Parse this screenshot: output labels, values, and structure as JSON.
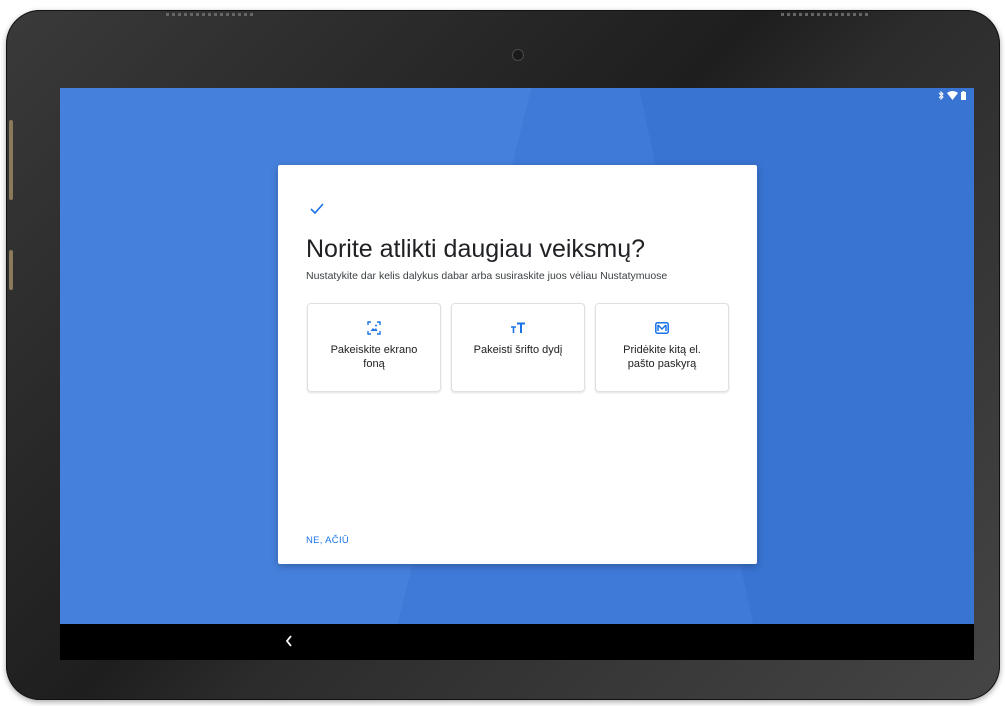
{
  "colors": {
    "accent": "#1a73e8",
    "wallpaper": "#3f7ad8",
    "bezel": "#2b2b2b",
    "navbar": "#000000",
    "card_bg": "#ffffff",
    "title_text": "#202124",
    "body_text": "#3c4043"
  },
  "status_bar": {
    "icons": [
      "bluetooth-icon",
      "wifi-icon",
      "battery-icon"
    ]
  },
  "dialog": {
    "check_icon": "check-icon",
    "title": "Norite atlikti daugiau veiksmų?",
    "subtitle": "Nustatykite dar kelis dalykus dabar arba susiraskite juos vėliau Nustatymuose",
    "options": [
      {
        "icon": "wallpaper-icon",
        "label": "Pakeiskite ekrano foną"
      },
      {
        "icon": "font-size-icon",
        "label": "Pakeisti šrifto dydį"
      },
      {
        "icon": "email-icon",
        "label": "Pridėkite kitą el. pašto paskyrą"
      }
    ],
    "dismiss_label": "NE, AČIŪ"
  },
  "nav_bar": {
    "back_icon": "back-chevron-icon"
  }
}
